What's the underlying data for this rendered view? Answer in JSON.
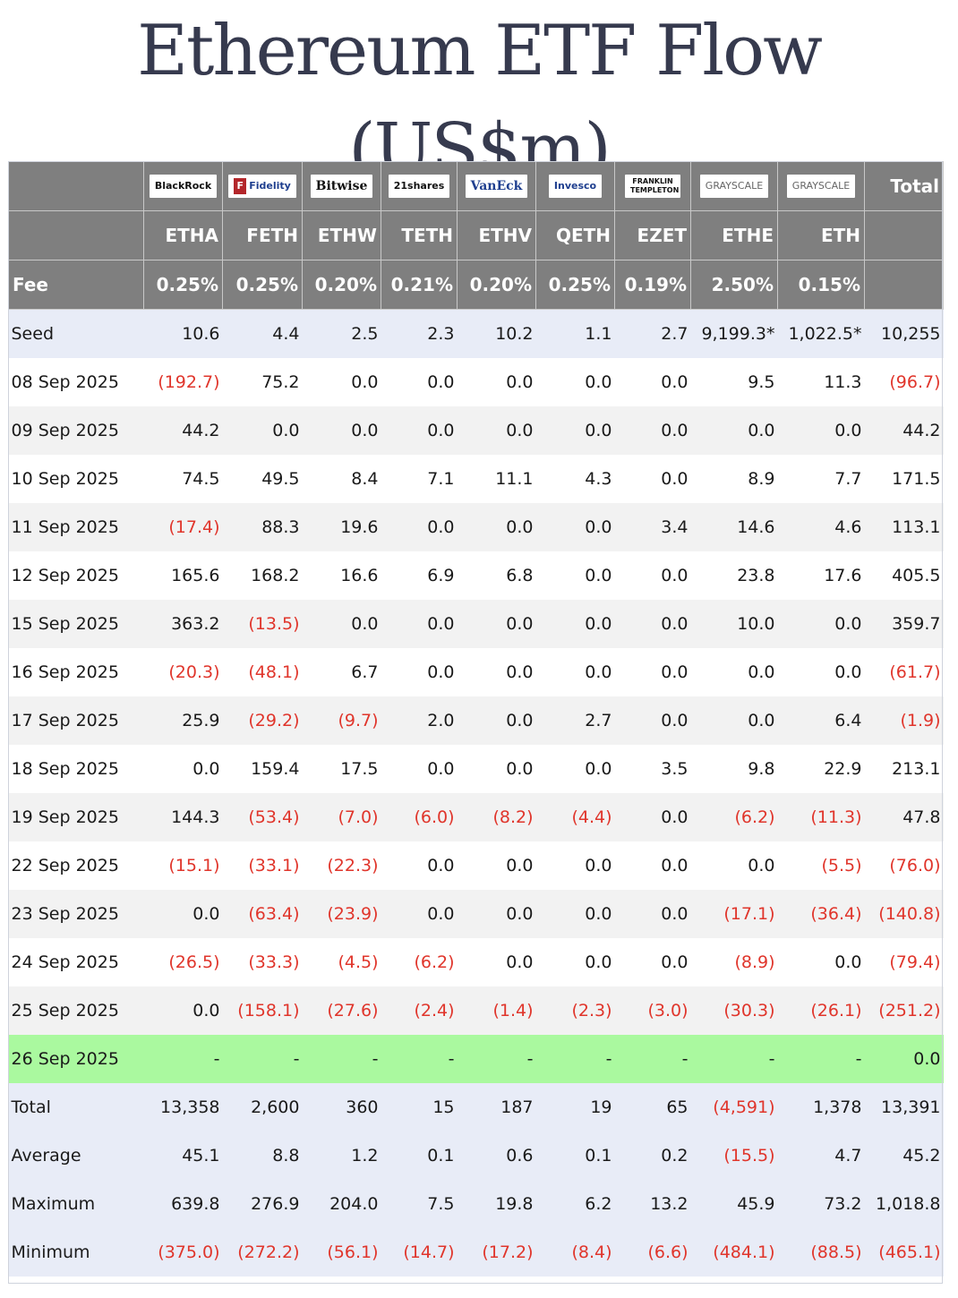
{
  "title": "Ethereum ETF Flow (US$m)",
  "issuers": [
    {
      "name": "BlackRock",
      "icon": "blackrock-logo"
    },
    {
      "name": "Fidelity",
      "icon": "fidelity-logo"
    },
    {
      "name": "Bitwise",
      "icon": "bitwise-logo"
    },
    {
      "name": "21shares",
      "icon": "21shares-logo"
    },
    {
      "name": "VanEck",
      "icon": "vaneck-logo"
    },
    {
      "name": "Invesco",
      "icon": "invesco-logo"
    },
    {
      "name": "FRANKLIN TEMPLETON",
      "icon": "franklin-templeton-logo"
    },
    {
      "name": "GRAYSCALE",
      "icon": "grayscale-logo"
    },
    {
      "name": "GRAYSCALE",
      "icon": "grayscale-logo"
    }
  ],
  "total_header": "Total",
  "tickers": [
    "ETHA",
    "FETH",
    "ETHW",
    "TETH",
    "ETHV",
    "QETH",
    "EZET",
    "ETHE",
    "ETH"
  ],
  "fee_label": "Fee",
  "fees": [
    "0.25%",
    "0.25%",
    "0.20%",
    "0.21%",
    "0.20%",
    "0.25%",
    "0.19%",
    "2.50%",
    "0.15%"
  ],
  "rows": [
    {
      "label": "Seed",
      "type": "seed",
      "values": [
        "10.6",
        "4.4",
        "2.5",
        "2.3",
        "10.2",
        "1.1",
        "2.7",
        "9,199.3*",
        "1,022.5*",
        "10,255"
      ]
    },
    {
      "label": "08 Sep 2025",
      "type": "even",
      "values": [
        "(192.7)",
        "75.2",
        "0.0",
        "0.0",
        "0.0",
        "0.0",
        "0.0",
        "9.5",
        "11.3",
        "(96.7)"
      ]
    },
    {
      "label": "09 Sep 2025",
      "type": "odd",
      "values": [
        "44.2",
        "0.0",
        "0.0",
        "0.0",
        "0.0",
        "0.0",
        "0.0",
        "0.0",
        "0.0",
        "44.2"
      ]
    },
    {
      "label": "10 Sep 2025",
      "type": "even",
      "values": [
        "74.5",
        "49.5",
        "8.4",
        "7.1",
        "11.1",
        "4.3",
        "0.0",
        "8.9",
        "7.7",
        "171.5"
      ]
    },
    {
      "label": "11 Sep 2025",
      "type": "odd",
      "values": [
        "(17.4)",
        "88.3",
        "19.6",
        "0.0",
        "0.0",
        "0.0",
        "3.4",
        "14.6",
        "4.6",
        "113.1"
      ]
    },
    {
      "label": "12 Sep 2025",
      "type": "even",
      "values": [
        "165.6",
        "168.2",
        "16.6",
        "6.9",
        "6.8",
        "0.0",
        "0.0",
        "23.8",
        "17.6",
        "405.5"
      ]
    },
    {
      "label": "15 Sep 2025",
      "type": "odd",
      "values": [
        "363.2",
        "(13.5)",
        "0.0",
        "0.0",
        "0.0",
        "0.0",
        "0.0",
        "10.0",
        "0.0",
        "359.7"
      ]
    },
    {
      "label": "16 Sep 2025",
      "type": "even",
      "values": [
        "(20.3)",
        "(48.1)",
        "6.7",
        "0.0",
        "0.0",
        "0.0",
        "0.0",
        "0.0",
        "0.0",
        "(61.7)"
      ]
    },
    {
      "label": "17 Sep 2025",
      "type": "odd",
      "values": [
        "25.9",
        "(29.2)",
        "(9.7)",
        "2.0",
        "0.0",
        "2.7",
        "0.0",
        "0.0",
        "6.4",
        "(1.9)"
      ]
    },
    {
      "label": "18 Sep 2025",
      "type": "even",
      "values": [
        "0.0",
        "159.4",
        "17.5",
        "0.0",
        "0.0",
        "0.0",
        "3.5",
        "9.8",
        "22.9",
        "213.1"
      ]
    },
    {
      "label": "19 Sep 2025",
      "type": "odd",
      "values": [
        "144.3",
        "(53.4)",
        "(7.0)",
        "(6.0)",
        "(8.2)",
        "(4.4)",
        "0.0",
        "(6.2)",
        "(11.3)",
        "47.8"
      ]
    },
    {
      "label": "22 Sep 2025",
      "type": "even",
      "values": [
        "(15.1)",
        "(33.1)",
        "(22.3)",
        "0.0",
        "0.0",
        "0.0",
        "0.0",
        "0.0",
        "(5.5)",
        "(76.0)"
      ]
    },
    {
      "label": "23 Sep 2025",
      "type": "odd",
      "values": [
        "0.0",
        "(63.4)",
        "(23.9)",
        "0.0",
        "0.0",
        "0.0",
        "0.0",
        "(17.1)",
        "(36.4)",
        "(140.8)"
      ]
    },
    {
      "label": "24 Sep 2025",
      "type": "even",
      "values": [
        "(26.5)",
        "(33.3)",
        "(4.5)",
        "(6.2)",
        "0.0",
        "0.0",
        "0.0",
        "(8.9)",
        "0.0",
        "(79.4)"
      ]
    },
    {
      "label": "25 Sep 2025",
      "type": "odd",
      "values": [
        "0.0",
        "(158.1)",
        "(27.6)",
        "(2.4)",
        "(1.4)",
        "(2.3)",
        "(3.0)",
        "(30.3)",
        "(26.1)",
        "(251.2)"
      ]
    },
    {
      "label": "26 Sep 2025",
      "type": "today",
      "values": [
        "-",
        "-",
        "-",
        "-",
        "-",
        "-",
        "-",
        "-",
        "-",
        "0.0"
      ]
    },
    {
      "label": "Total",
      "type": "stat",
      "values": [
        "13,358",
        "2,600",
        "360",
        "15",
        "187",
        "19",
        "65",
        "(4,591)",
        "1,378",
        "13,391"
      ]
    },
    {
      "label": "Average",
      "type": "stat",
      "values": [
        "45.1",
        "8.8",
        "1.2",
        "0.1",
        "0.6",
        "0.1",
        "0.2",
        "(15.5)",
        "4.7",
        "45.2"
      ]
    },
    {
      "label": "Maximum",
      "type": "stat",
      "values": [
        "639.8",
        "276.9",
        "204.0",
        "7.5",
        "19.8",
        "6.2",
        "13.2",
        "45.9",
        "73.2",
        "1,018.8"
      ]
    },
    {
      "label": "Minimum",
      "type": "stat",
      "values": [
        "(375.0)",
        "(272.2)",
        "(56.1)",
        "(14.7)",
        "(17.2)",
        "(8.4)",
        "(6.6)",
        "(484.1)",
        "(88.5)",
        "(465.1)"
      ]
    }
  ],
  "colors": {
    "header_bg": "#7f7f7f",
    "negative": "#e0352b",
    "highlight_row": "#aaf99f",
    "stat_row": "#e8ecf7",
    "title": "#363a4e"
  }
}
